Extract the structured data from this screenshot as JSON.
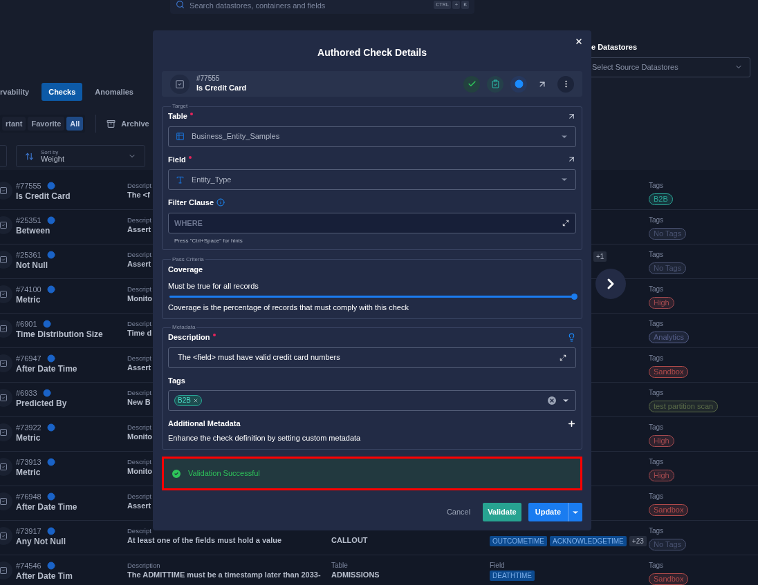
{
  "search": {
    "placeholder": "Search datastores, containers and fields",
    "keys": [
      "CTRL",
      "+",
      "K"
    ]
  },
  "source_datastores": {
    "label": "e Datastores",
    "placeholder": "Select Source Datastores"
  },
  "tabs": [
    {
      "label": "rvability",
      "selected": false
    },
    {
      "label": "Checks",
      "selected": true
    },
    {
      "label": "Anomalies",
      "selected": false
    }
  ],
  "filters": [
    {
      "label": "rtant",
      "selected": false
    },
    {
      "label": "Favorite",
      "selected": false
    },
    {
      "label": "All",
      "selected": true
    }
  ],
  "archive": {
    "label": "Archive"
  },
  "sort": {
    "label": "Sort by",
    "value": "Weight"
  },
  "checks": [
    {
      "id": "#77555",
      "name": "Is Credit Card",
      "description_label": "Descript",
      "description": "The <f",
      "tags_label": "Tags",
      "tag": {
        "label": "B2B",
        "color": "#2aa597"
      }
    },
    {
      "id": "#25351",
      "name": "Between",
      "description_label": "Descript",
      "description": "Assert",
      "tags_label": "Tags",
      "tag": {
        "label": "No Tags",
        "color": "#4a5372"
      }
    },
    {
      "id": "#25361",
      "name": "Not Null",
      "description_label": "Descript",
      "description": "Assert",
      "field_more": "+1",
      "tags_label": "Tags",
      "tag": {
        "label": "No Tags",
        "color": "#4a5372"
      }
    },
    {
      "id": "#74100",
      "name": "Metric",
      "description_label": "Descript",
      "description": "Monito",
      "tags_label": "Tags",
      "tag": {
        "label": "High",
        "color": "#a34a4f"
      }
    },
    {
      "id": "#6901",
      "name": "Time Distribution Size",
      "description_label": "Descript",
      "description": "Time d",
      "tags_label": "Tags",
      "tag": {
        "label": "Analytics",
        "color": "#565f8a"
      }
    },
    {
      "id": "#76947",
      "name": "After Date Time",
      "description_label": "Descript",
      "description": "Assert",
      "tags_label": "Tags",
      "tag": {
        "label": "Sandbox",
        "color": "#b04a4a"
      }
    },
    {
      "id": "#6933",
      "name": "Predicted By",
      "description_label": "Descript",
      "description": "New B",
      "tags_label": "Tags",
      "tag": {
        "label": "test partition scan",
        "color": "#5a6b48"
      }
    },
    {
      "id": "#73922",
      "name": "Metric",
      "description_label": "Descript",
      "description": "Monito",
      "tags_label": "Tags",
      "tag": {
        "label": "High",
        "color": "#a34a4f"
      }
    },
    {
      "id": "#73913",
      "name": "Metric",
      "description_label": "Descript",
      "description": "Monito",
      "tags_label": "Tags",
      "tag": {
        "label": "High",
        "color": "#a34a4f"
      }
    },
    {
      "id": "#76948",
      "name": "After Date Time",
      "description_label": "Descript",
      "description": "Assert",
      "tags_label": "Tags",
      "tag": {
        "label": "Sandbox",
        "color": "#b04a4a"
      }
    },
    {
      "id": "#73917",
      "name": "Any Not Null",
      "description_label": "Descript",
      "description": "At least one of the fields must hold a value",
      "table": "CALLOUT",
      "fields": [
        "OUTCOMETIME",
        "ACKNOWLEDGETIME"
      ],
      "field_more": "+23",
      "tags_label": "Tags",
      "tag": {
        "label": "No Tags",
        "color": "#4a5372"
      }
    },
    {
      "id": "#74546",
      "name": "After Date Tim",
      "description_label": "Description",
      "description": "The ADMITTIME must be a timestamp later than 2033-",
      "table_label": "Table",
      "table": "ADMISSIONS",
      "field_label": "Field",
      "fields": [
        "DEATHTIME"
      ],
      "tags_label": "Tags",
      "tag": {
        "label": "Sandbox",
        "color": "#b04a4a"
      }
    }
  ],
  "modal": {
    "title": "Authored Check Details",
    "check": {
      "id": "#77555",
      "name": "Is Credit Card"
    },
    "target": {
      "legend": "Target",
      "table_label": "Table",
      "table_value": "Business_Entity_Samples",
      "field_label": "Field",
      "field_value": "Entity_Type",
      "filter_label": "Filter Clause",
      "filter_placeholder": "WHERE",
      "filter_hint": "Press \"Ctrl+Space\" for hints"
    },
    "pass_criteria": {
      "legend": "Pass Criteria",
      "title": "Coverage",
      "rule": "Must be true for all records",
      "level": 1.0,
      "help": "Coverage is the percentage of records that must comply with this check"
    },
    "metadata": {
      "legend": "Metadata",
      "description_label": "Description",
      "description_value": "The <field> must have valid credit card numbers",
      "tags_label": "Tags",
      "tags": [
        "B2B"
      ],
      "additional_label": "Additional Metadata",
      "additional_help": "Enhance the check definition by setting custom metadata"
    },
    "validation": {
      "message": "Validation Successful"
    },
    "buttons": {
      "cancel": "Cancel",
      "validate": "Validate",
      "update": "Update"
    }
  }
}
